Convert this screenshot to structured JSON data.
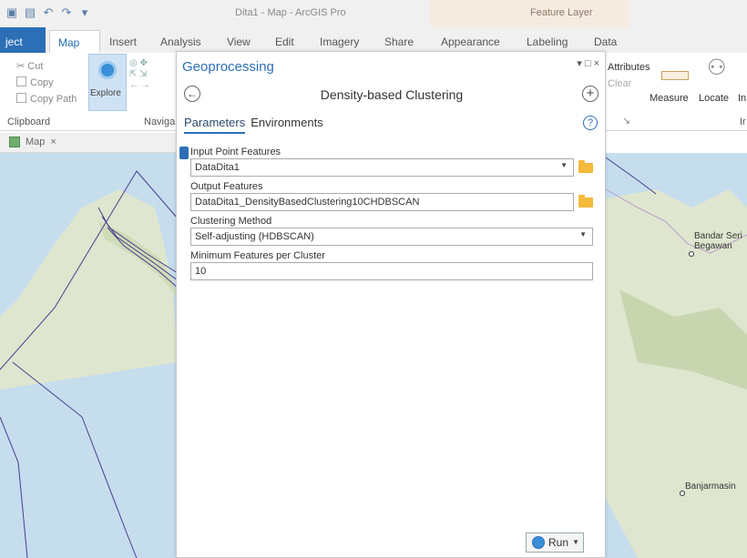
{
  "window": {
    "title": "Dita1 - Map - ArcGIS Pro",
    "context_title": "Feature Layer"
  },
  "tabs": {
    "project": "ject",
    "map": "Map",
    "insert": "Insert",
    "analysis": "Analysis",
    "view": "View",
    "edit": "Edit",
    "imagery": "Imagery",
    "share": "Share",
    "appearance": "Appearance",
    "labeling": "Labeling",
    "data": "Data"
  },
  "ribbon": {
    "cut": "Cut",
    "copy": "Copy",
    "copy_path": "Copy Path",
    "clipboard": "Clipboard",
    "explore": "Explore",
    "navigate": "Naviga",
    "attributes": "Attributes",
    "clear": "Clear",
    "measure": "Measure",
    "locate": "Locate",
    "more": "In",
    "more_group": "Ir"
  },
  "map_view": {
    "tab_label": "Map",
    "close": "×",
    "places": [
      "Bandar Seri",
      "Begawan",
      "Banjarmasin"
    ]
  },
  "geoprocessing": {
    "pane_title": "Geoprocessing",
    "window_controls": "▾ □ ×",
    "tool_name": "Density-based Clustering",
    "tabs": [
      "Parameters",
      "Environments"
    ],
    "params": {
      "input_label": "Input Point Features",
      "input_value": "DataDita1",
      "output_label": "Output Features",
      "output_value": "DataDita1_DensityBasedClustering10CHDBSCAN",
      "method_label": "Clustering Method",
      "method_value": "Self-adjusting (HDBSCAN)",
      "min_label": "Minimum Features per Cluster",
      "min_value": "10"
    },
    "run_label": "Run"
  },
  "colors": {
    "accent": "#2c6fb7",
    "context_band": "#f6ebe0",
    "folder": "#f5b93b",
    "map_sea": "#c6ddee",
    "map_land": "#dfe6cf",
    "boundary": "#4a3d8c"
  },
  "icons": [
    "save-icon",
    "undo-icon",
    "redo-icon",
    "cut-icon",
    "copy-icon",
    "explore-icon",
    "back-icon",
    "add-icon",
    "help-icon",
    "folder-icon",
    "run-icon",
    "info-icon",
    "map-icon"
  ]
}
